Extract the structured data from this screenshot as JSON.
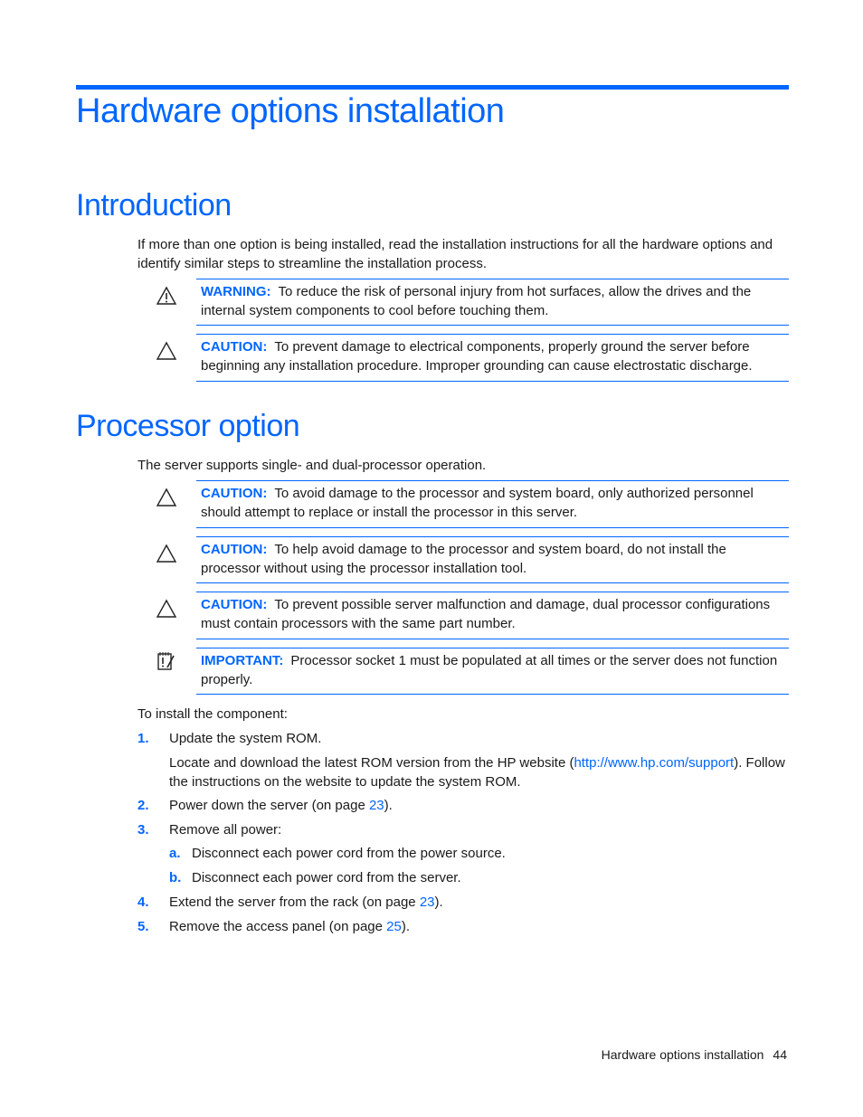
{
  "page": {
    "chapter_title": "Hardware options installation",
    "sections": [
      {
        "title": "Introduction",
        "intro": "If more than one option is being installed, read the installation instructions for all the hardware options and identify similar steps to streamline the installation process.",
        "notes": [
          {
            "type": "warning",
            "icon": "warning-triangle-icon",
            "label": "WARNING:",
            "text": "To reduce the risk of personal injury from hot surfaces, allow the drives and the internal system components to cool before touching them."
          },
          {
            "type": "caution",
            "icon": "caution-triangle-icon",
            "label": "CAUTION:",
            "text": "To prevent damage to electrical components, properly ground the server before beginning any installation procedure. Improper grounding can cause electrostatic discharge."
          }
        ]
      },
      {
        "title": "Processor option",
        "intro": "The server supports single- and dual-processor operation.",
        "notes": [
          {
            "type": "caution",
            "icon": "caution-triangle-icon",
            "label": "CAUTION:",
            "text": "To avoid damage to the processor and system board, only authorized personnel should attempt to replace or install the processor in this server."
          },
          {
            "type": "caution",
            "icon": "caution-triangle-icon",
            "label": "CAUTION:",
            "text": "To help avoid damage to the processor and system board, do not install the processor without using the processor installation tool."
          },
          {
            "type": "caution",
            "icon": "caution-triangle-icon",
            "label": "CAUTION:",
            "text": "To prevent possible server malfunction and damage, dual processor configurations must contain processors with the same part number."
          },
          {
            "type": "important",
            "icon": "important-notepad-icon",
            "label": "IMPORTANT:",
            "text": "Processor socket 1 must be populated at all times or the server does not function properly."
          }
        ],
        "procedure_intro": "To install the component:",
        "steps": [
          {
            "num": "1.",
            "text": "Update the system ROM.",
            "detail_before": "Locate and download the latest ROM version from the HP website (",
            "detail_link": "http://www.hp.com/support",
            "detail_after": "). Follow the instructions on the website to update the system ROM."
          },
          {
            "num": "2.",
            "text": "Power down the server (on page ",
            "link": "23",
            "after": ")."
          },
          {
            "num": "3.",
            "text": "Remove all power:"
          },
          {
            "num": "a.",
            "text": "Disconnect each power cord from the power source."
          },
          {
            "num": "b.",
            "text": "Disconnect each power cord from the server."
          },
          {
            "num": "4.",
            "text": "Extend the server from the rack (on page ",
            "link": "23",
            "after": ")."
          },
          {
            "num": "5.",
            "text": "Remove the access panel (on page ",
            "link": "25",
            "after": ")."
          }
        ]
      }
    ],
    "footer": {
      "section": "Hardware options installation",
      "page_number": "44"
    }
  }
}
